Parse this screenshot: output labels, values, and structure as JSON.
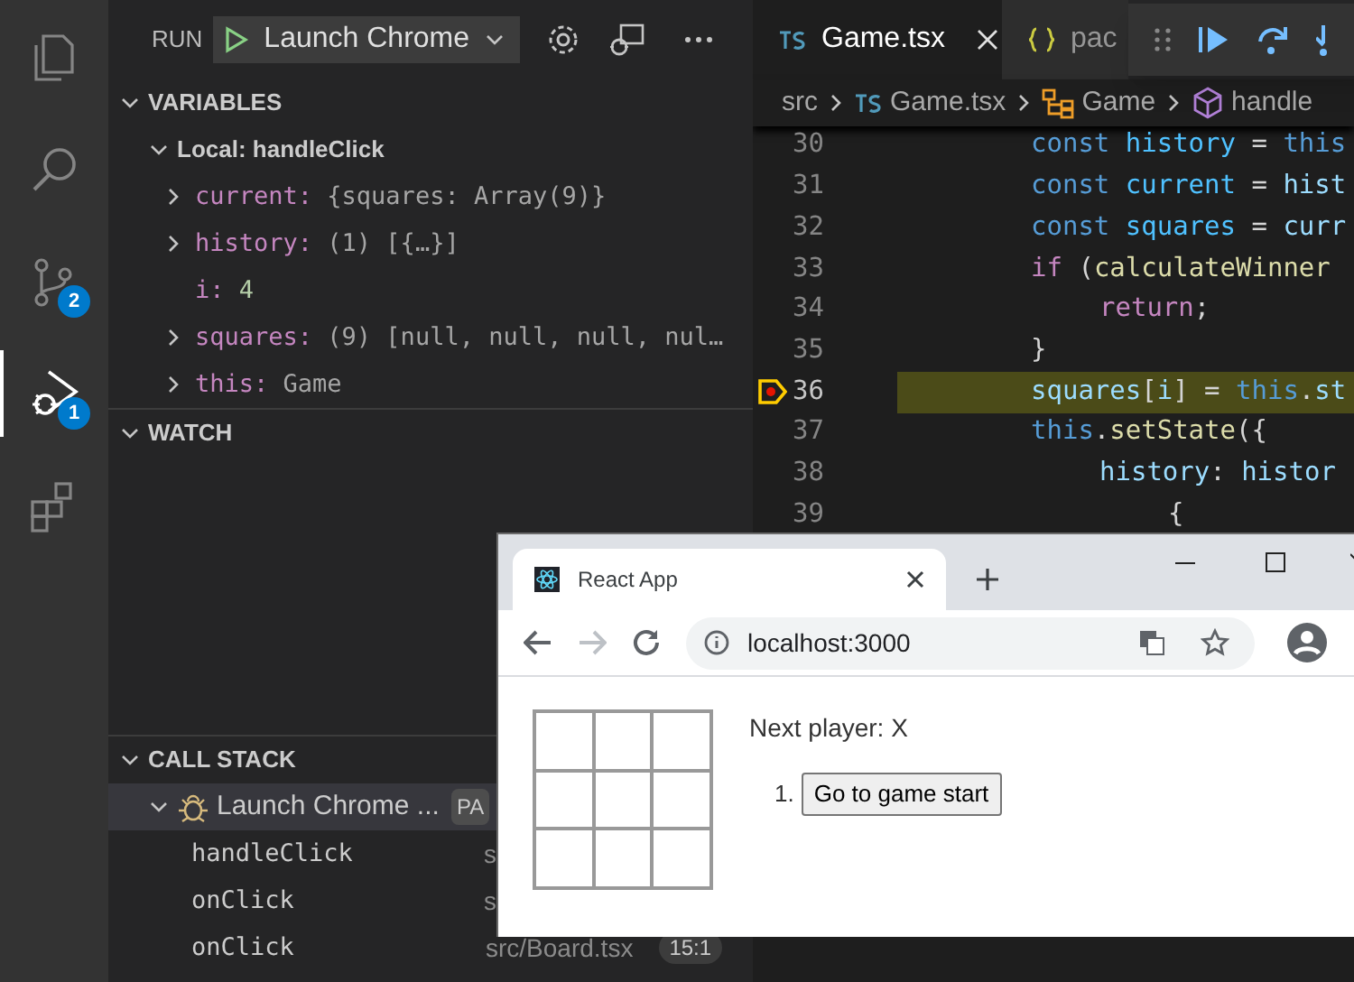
{
  "activity_bar": {
    "items": [
      {
        "kind": "explorer",
        "selected": false
      },
      {
        "kind": "search",
        "selected": false
      },
      {
        "kind": "source_control",
        "selected": false,
        "badge": "2"
      },
      {
        "kind": "debug",
        "selected": true,
        "badge": "1"
      },
      {
        "kind": "extensions",
        "selected": false
      }
    ]
  },
  "run_bar": {
    "label": "RUN",
    "configuration": "Launch Chrome"
  },
  "variables": {
    "title": "VARIABLES",
    "expanded": true,
    "scope": {
      "label": "Local: handleClick",
      "expanded": true,
      "items": [
        {
          "name": "current:",
          "value": "{squares: Array(9)}",
          "expandable": true,
          "kind": "object"
        },
        {
          "name": "history:",
          "value": "(1) [{…}]",
          "expandable": true,
          "kind": "object"
        },
        {
          "name": "i:",
          "value": "4",
          "expandable": false,
          "kind": "number"
        },
        {
          "name": "squares:",
          "value": "(9) [null, null, null, nul…",
          "expandable": true,
          "kind": "object"
        },
        {
          "name": "this:",
          "value": "Game",
          "expandable": true,
          "kind": "object"
        }
      ]
    }
  },
  "watch": {
    "title": "WATCH",
    "expanded": true
  },
  "call_stack": {
    "title": "CALL STACK",
    "expanded": true,
    "session": {
      "label": "Launch Chrome ...",
      "badge": "PA",
      "selected": true
    },
    "frames": [
      {
        "name": "handleClick",
        "file": "s"
      },
      {
        "name": "onClick",
        "file": "s"
      },
      {
        "name": "onClick",
        "file": "src/Board.tsx",
        "position": "15:1"
      }
    ]
  },
  "editor": {
    "tabs": [
      {
        "label": "Game.tsx",
        "kind": "ts",
        "selected": true
      },
      {
        "label": "pac",
        "kind": "json",
        "selected": false
      }
    ],
    "breadcrumb": [
      {
        "label": "src",
        "kind": "folder"
      },
      {
        "label": "Game.tsx",
        "kind": "ts"
      },
      {
        "label": "Game",
        "kind": "class"
      },
      {
        "label": "handle",
        "kind": "method"
      }
    ],
    "lines": [
      {
        "number": "30",
        "current": false,
        "tokens": [
          {
            "text": "const ",
            "kind": "keyword"
          },
          {
            "text": "history",
            "kind": "constant"
          },
          {
            "text": " = ",
            "kind": "plain"
          },
          {
            "text": "this",
            "kind": "keyword"
          }
        ]
      },
      {
        "number": "31",
        "current": false,
        "tokens": [
          {
            "text": "const ",
            "kind": "keyword"
          },
          {
            "text": "current",
            "kind": "constant"
          },
          {
            "text": " = ",
            "kind": "plain"
          },
          {
            "text": "hist",
            "kind": "variable"
          }
        ]
      },
      {
        "number": "32",
        "current": false,
        "tokens": [
          {
            "text": "const ",
            "kind": "keyword"
          },
          {
            "text": "squares",
            "kind": "constant"
          },
          {
            "text": " = ",
            "kind": "plain"
          },
          {
            "text": "curr",
            "kind": "variable"
          }
        ]
      },
      {
        "number": "33",
        "current": false,
        "tokens": [
          {
            "text": "if",
            "kind": "control"
          },
          {
            "text": " (",
            "kind": "plain"
          },
          {
            "text": "calculateWinner",
            "kind": "function"
          }
        ],
        "children": [
          {
            "number": "34",
            "current": false,
            "tokens": [
              {
                "text": "return",
                "kind": "control"
              },
              {
                "text": ";",
                "kind": "plain"
              }
            ]
          }
        ]
      },
      {
        "number": "35",
        "current": false,
        "tokens": [
          {
            "text": "}",
            "kind": "plain"
          }
        ]
      },
      {
        "number": "36",
        "current": true,
        "tokens": [
          {
            "text": "squares",
            "kind": "variable"
          },
          {
            "text": "[",
            "kind": "plain"
          },
          {
            "text": "i",
            "kind": "variable"
          },
          {
            "text": "] = ",
            "kind": "plain"
          },
          {
            "text": "this",
            "kind": "keyword"
          },
          {
            "text": ".",
            "kind": "plain"
          },
          {
            "text": "st",
            "kind": "variable"
          }
        ]
      },
      {
        "number": "37",
        "current": false,
        "tokens": [
          {
            "text": "this",
            "kind": "keyword"
          },
          {
            "text": ".",
            "kind": "plain"
          },
          {
            "text": "setState",
            "kind": "function"
          },
          {
            "text": "({",
            "kind": "plain"
          }
        ],
        "children": [
          {
            "number": "38",
            "current": false,
            "tokens": [
              {
                "text": "history",
                "kind": "variable"
              },
              {
                "text": ": ",
                "kind": "plain"
              },
              {
                "text": "histor",
                "kind": "variable"
              }
            ],
            "children": [
              {
                "number": "39",
                "current": false,
                "tokens": [
                  {
                    "text": "{",
                    "kind": "plain"
                  }
                ]
              }
            ]
          }
        ]
      }
    ]
  },
  "browser": {
    "tab": {
      "title": "React App"
    },
    "address": "localhost:3000",
    "forward_disabled": true,
    "page": {
      "status": "Next player: X",
      "moves": [
        {
          "number": "1.",
          "label": "Go to game start"
        }
      ]
    }
  }
}
